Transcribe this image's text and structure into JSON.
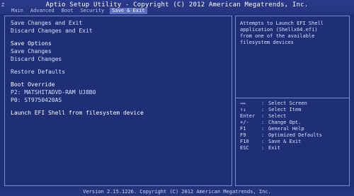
{
  "header": {
    "title": "Aptio Setup Utility - Copyright (C) 2012 American Megatrends, Inc.",
    "tabs": [
      {
        "label": "Main"
      },
      {
        "label": "Advanced"
      },
      {
        "label": "Boot"
      },
      {
        "label": "Security"
      },
      {
        "label": "Save & Exit"
      }
    ],
    "active_tab": "Save & Exit"
  },
  "left_panel": {
    "items": [
      {
        "label": "Save Changes and Exit"
      },
      {
        "label": "Discard Changes and Exit"
      },
      {
        "label": "Save Options"
      },
      {
        "label": "Save Changes"
      },
      {
        "label": "Discard Changes"
      },
      {
        "label": "Restore Defaults"
      },
      {
        "label": "Boot Override"
      },
      {
        "label": "P2: MATSHITADVD-RAM UJ8B0"
      },
      {
        "label": "P0: ST9750420AS"
      },
      {
        "label": "Launch EFI Shell from filesystem device"
      }
    ]
  },
  "right_panel": {
    "help_lines": [
      "Attempts to Launch EFI Shell",
      "application (Shellx64.efi)",
      "from one of the available",
      "filesystem devices"
    ],
    "keys": [
      {
        "key": "→←",
        "desc": "Select Screen"
      },
      {
        "key": "↑↓",
        "desc": "Select Item"
      },
      {
        "key": "Enter",
        "desc": "Select"
      },
      {
        "key": "+/-",
        "desc": "Change Opt."
      },
      {
        "key": "F1",
        "desc": "General Help"
      },
      {
        "key": "F9",
        "desc": "Optimized Defaults"
      },
      {
        "key": "F10",
        "desc": "Save & Exit"
      },
      {
        "key": "ESC",
        "desc": "Exit"
      }
    ]
  },
  "footer": {
    "text": "Version 2.15.1226. Copyright (C) 2012 American Megatrends, Inc."
  },
  "colors": {
    "background": "#1e2f75",
    "border": "#7c8cd3",
    "active_tab": "#5b6dc0"
  }
}
